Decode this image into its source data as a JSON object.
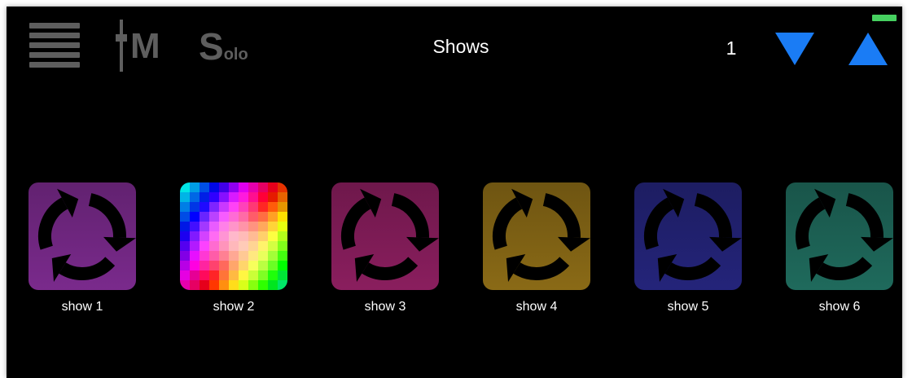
{
  "topbar": {
    "mute_letter": "M",
    "solo_big": "S",
    "solo_small": "olo",
    "title": "Shows",
    "page_number": "1"
  },
  "colors": {
    "accent": "#1a7cf5",
    "battery": "#46d060",
    "icon_gray": "#5e5e5e"
  },
  "shows": [
    {
      "label": "show 1",
      "icon": "cycle-icon",
      "color": "#7a2a8c"
    },
    {
      "label": "show 2",
      "icon": "color-palette-icon",
      "color": "#ffffff"
    },
    {
      "label": "show 3",
      "icon": "cycle-icon",
      "color": "#8a1e5e"
    },
    {
      "label": "show 4",
      "icon": "cycle-icon",
      "color": "#8a6a16"
    },
    {
      "label": "show 5",
      "icon": "cycle-icon",
      "color": "#24247a"
    },
    {
      "label": "show 6",
      "icon": "cycle-icon",
      "color": "#1f6a5c"
    }
  ]
}
